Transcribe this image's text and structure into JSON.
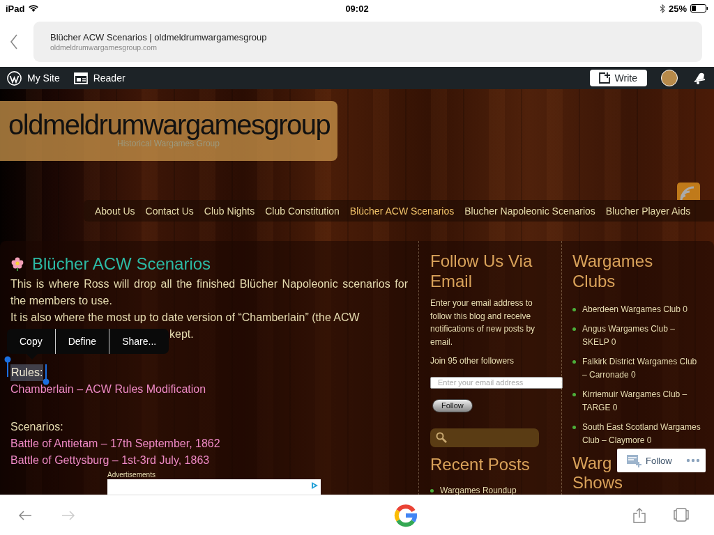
{
  "status_bar": {
    "device": "iPad",
    "time": "09:02",
    "battery": "25%"
  },
  "address_bar": {
    "title": "Blücher ACW Scenarios | oldmeldrumwargamesgroup",
    "url": "oldmeldrumwargamesgroup.com"
  },
  "admin_bar": {
    "items": [
      "My Site",
      "Reader"
    ],
    "write": "Write"
  },
  "site": {
    "title": "oldmeldrumwargamesgroup",
    "tagline": "Historical Wargames Group"
  },
  "nav": [
    {
      "label": "About Us",
      "selected": false
    },
    {
      "label": "Contact Us",
      "selected": false
    },
    {
      "label": "Club Nights",
      "selected": false
    },
    {
      "label": "Club Constitution",
      "selected": false
    },
    {
      "label": "Blücher ACW Scenarios",
      "selected": true
    },
    {
      "label": "Blucher Napoleonic Scenarios",
      "selected": false
    },
    {
      "label": "Blucher Player Aids",
      "selected": false
    }
  ],
  "post": {
    "title": "Blücher ACW Scenarios",
    "paragraph_1": "This is where Ross will drop all the finished Blücher Napoleonic scenarios for the members to use.",
    "paragraph_2": "It is also where the most up to date version of “Chamberlain” (the ACW",
    "paragraph_2_end": "kept.",
    "rules": {
      "heading": "Rules:",
      "selected": true,
      "links": [
        "Chamberlain – ACW Rules Modification"
      ]
    },
    "scenarios": {
      "heading": "Scenarios:",
      "links": [
        "Battle of Antietam – 17th September, 1862",
        "Battle of Gettysburg – 1st-3rd July, 1863"
      ]
    },
    "ad_label": "Advertisements"
  },
  "context_menu": [
    "Copy",
    "Define",
    "Share..."
  ],
  "follow_widget": {
    "title": "Follow Us Via Email",
    "text": "Enter your email address to follow this blog and receive notifications of new posts by email.",
    "followers": "Join 95 other followers",
    "placeholder": "Enter your email address",
    "button": "Follow"
  },
  "recent_posts": {
    "title": "Recent Posts",
    "items": [
      "Wargames Roundup"
    ]
  },
  "clubs": {
    "title": "Wargames Clubs",
    "items": [
      "Aberdeen Wargames Club 0",
      "Angus Wargames Club – SKELP 0",
      "Falkirk District Wargames Club – Carronade 0",
      "Kirriemuir Wargames Club – TARGE 0",
      "South East Scotland Wargames Club – Claymore 0"
    ]
  },
  "shows_heading": [
    "Warg",
    "Shows"
  ],
  "follow_popup": {
    "label": "Follow"
  },
  "toolbar": {
    "back_disabled": false,
    "forward_disabled": true
  }
}
